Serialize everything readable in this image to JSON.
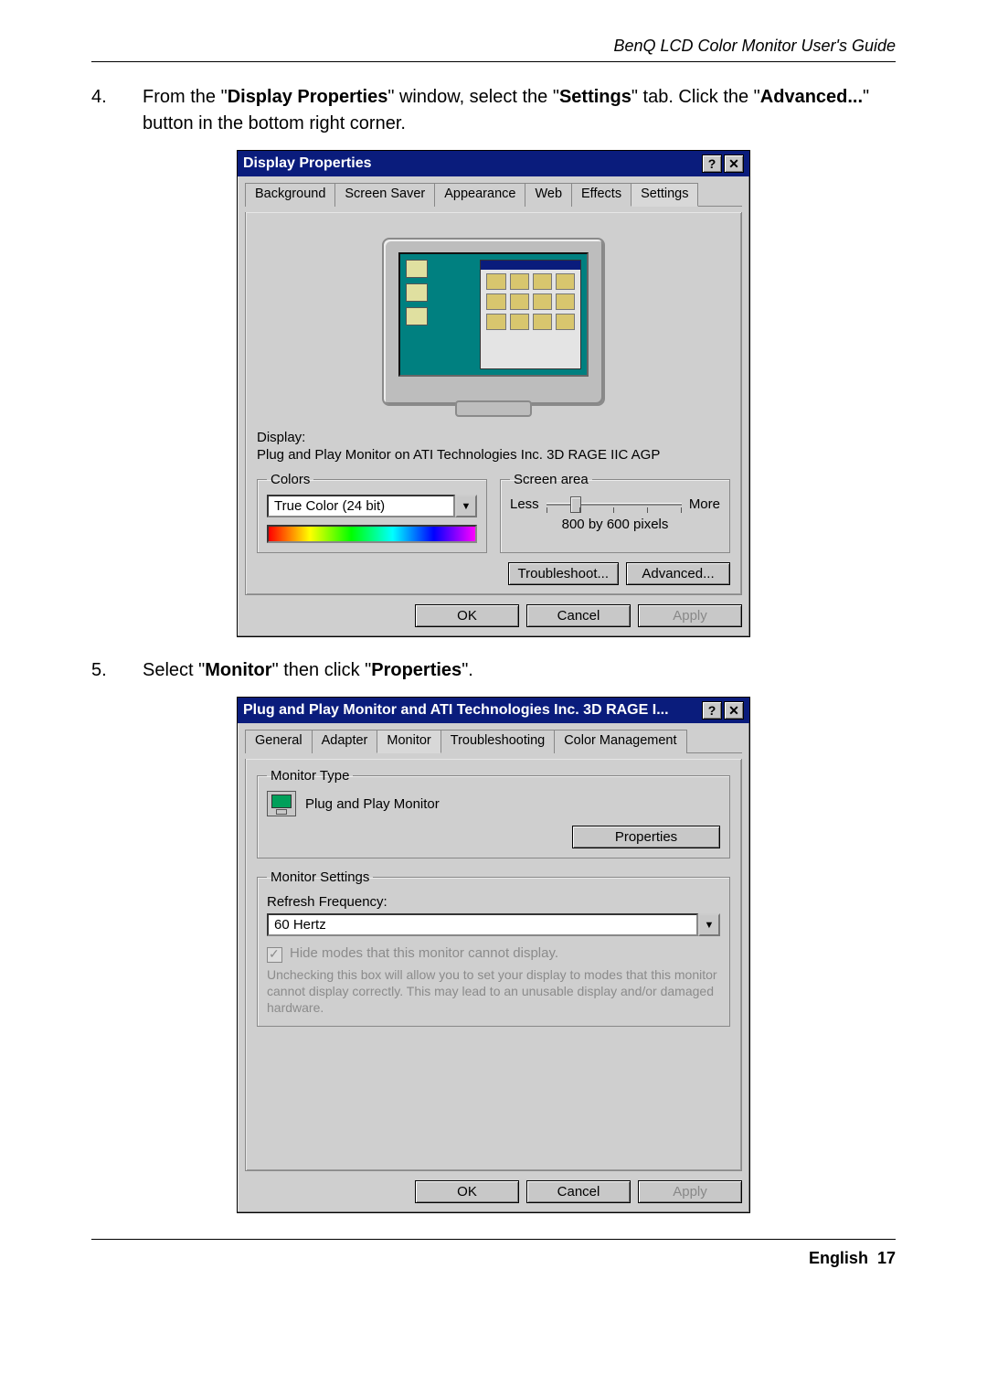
{
  "header": {
    "title": "BenQ LCD Color Monitor User's Guide"
  },
  "steps": {
    "s4": {
      "num": "4.",
      "text_pre": "From the \"",
      "bold1": "Display Properties",
      "mid1": "\" window, select the \"",
      "bold2": "Settings",
      "mid2": "\" tab. Click the \"",
      "bold3": "Advanced...",
      "post": "\" button in the bottom right corner."
    },
    "s5": {
      "num": "5.",
      "text_pre": "Select \"",
      "bold1": "Monitor",
      "mid1": "\" then click \"",
      "bold2": "Properties",
      "post": "\"."
    }
  },
  "dlg1": {
    "title": "Display Properties",
    "help": "?",
    "close": "✕",
    "tabs": {
      "background": "Background",
      "screensaver": "Screen Saver",
      "appearance": "Appearance",
      "web": "Web",
      "effects": "Effects",
      "settings": "Settings"
    },
    "display_label": "Display:",
    "display_value": "Plug and Play Monitor on ATI Technologies Inc. 3D RAGE IIC AGP",
    "colors_legend": "Colors",
    "colors_value": "True Color (24 bit)",
    "screen_legend": "Screen area",
    "less": "Less",
    "more": "More",
    "resolution": "800 by 600 pixels",
    "troubleshoot": "Troubleshoot...",
    "advanced": "Advanced...",
    "ok": "OK",
    "cancel": "Cancel",
    "apply": "Apply"
  },
  "dlg2": {
    "title": "Plug and Play Monitor and ATI Technologies Inc. 3D RAGE I...",
    "help": "?",
    "close": "✕",
    "tabs": {
      "general": "General",
      "adapter": "Adapter",
      "monitor": "Monitor",
      "troubleshooting": "Troubleshooting",
      "colormgmt": "Color Management"
    },
    "montype_legend": "Monitor Type",
    "montype_value": "Plug and Play Monitor",
    "properties": "Properties",
    "monset_legend": "Monitor Settings",
    "refresh_label": "Refresh Frequency:",
    "refresh_value": "60 Hertz",
    "hide_label": "Hide modes that this monitor cannot display.",
    "hide_desc": "Unchecking this box will allow you to set your display to modes that this monitor cannot display correctly. This may lead to an unusable display and/or damaged hardware.",
    "ok": "OK",
    "cancel": "Cancel",
    "apply": "Apply"
  },
  "footer": {
    "lang": "English",
    "page": "17"
  }
}
